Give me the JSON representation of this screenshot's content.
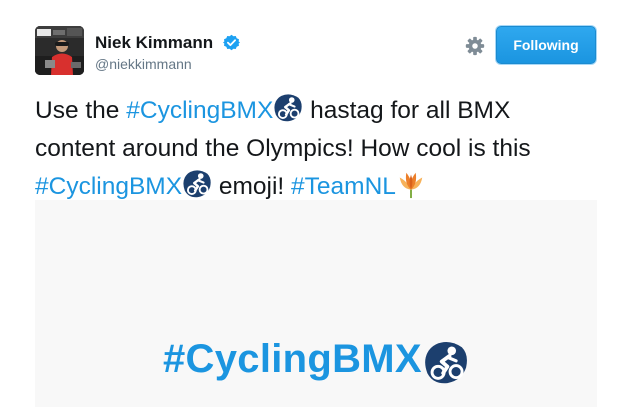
{
  "author": {
    "display_name": "Niek Kimmann",
    "username": "@niekkimmann",
    "verified": true,
    "avatar_icon": "rider-photo-avatar"
  },
  "actions": {
    "settings_icon": "gear-icon",
    "follow_label": "Following"
  },
  "tweet": {
    "line1_pre": "Use the ",
    "line1_hashtag": "#CyclingBMX",
    "line1_post": " hastag for all BMX",
    "line2": "content around the Olympics! How cool is this",
    "line3_hashtag": "#CyclingBMX",
    "line3_mid": " emoji! ",
    "line3_hashtag2": "#TeamNL"
  },
  "media": {
    "hashtag": "#CyclingBMX"
  },
  "colors": {
    "link": "#1b95e0",
    "text": "#14171a",
    "muted": "#657786",
    "button": "#1da1f2",
    "emoji_dark_blue": "#1c3f6e",
    "tulip_orange": "#f39c3c"
  }
}
